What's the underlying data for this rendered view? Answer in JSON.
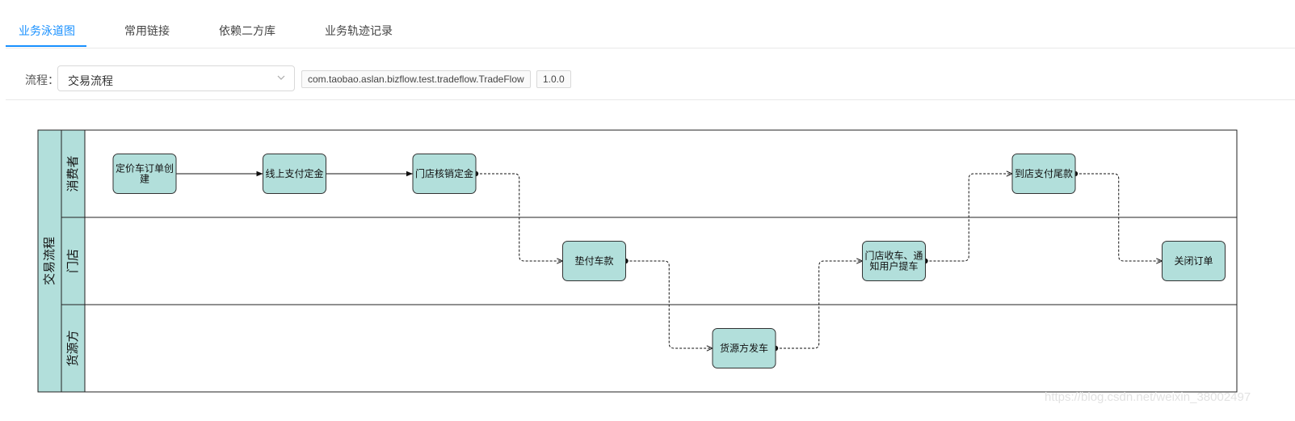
{
  "tabs": [
    {
      "label": "业务泳道图",
      "active": true
    },
    {
      "label": "常用链接",
      "active": false
    },
    {
      "label": "依赖二方库",
      "active": false
    },
    {
      "label": "业务轨迹记录",
      "active": false
    }
  ],
  "toolbar": {
    "flow_label": "流程：",
    "flow_select_value": "交易流程",
    "class_tag": "com.taobao.aslan.bizflow.test.tradeflow.TradeFlow",
    "version_tag": "1.0.0"
  },
  "diagram": {
    "pool_label": "交易流程",
    "lanes": [
      {
        "id": "consumer",
        "label": "消费者"
      },
      {
        "id": "store",
        "label": "门店"
      },
      {
        "id": "supplier",
        "label": "货源方"
      }
    ],
    "nodes": [
      {
        "id": "n1",
        "lane": "consumer",
        "lines": [
          "定价车订单创",
          "建"
        ]
      },
      {
        "id": "n2",
        "lane": "consumer",
        "lines": [
          "线上支付定金"
        ]
      },
      {
        "id": "n3",
        "lane": "consumer",
        "lines": [
          "门店核销定金"
        ]
      },
      {
        "id": "n4",
        "lane": "store",
        "lines": [
          "垫付车款"
        ]
      },
      {
        "id": "n5",
        "lane": "supplier",
        "lines": [
          "货源方发车"
        ]
      },
      {
        "id": "n6",
        "lane": "store",
        "lines": [
          "门店收车、通",
          "知用户提车"
        ]
      },
      {
        "id": "n7",
        "lane": "consumer",
        "lines": [
          "到店支付尾款"
        ]
      },
      {
        "id": "n8",
        "lane": "store",
        "lines": [
          "关闭订单"
        ]
      }
    ],
    "edges": [
      {
        "from": "n1",
        "to": "n2",
        "style": "solid"
      },
      {
        "from": "n2",
        "to": "n3",
        "style": "solid"
      },
      {
        "from": "n3",
        "to": "n4",
        "style": "dashed"
      },
      {
        "from": "n4",
        "to": "n5",
        "style": "dashed"
      },
      {
        "from": "n5",
        "to": "n6",
        "style": "dashed"
      },
      {
        "from": "n6",
        "to": "n7",
        "style": "dashed"
      },
      {
        "from": "n7",
        "to": "n8",
        "style": "dashed"
      }
    ],
    "colors": {
      "node_fill": "#b2dfdb",
      "lane_header_fill": "#b2dfdb",
      "accent": "#1890ff"
    }
  },
  "watermark": "https://blog.csdn.net/weixin_38002497"
}
